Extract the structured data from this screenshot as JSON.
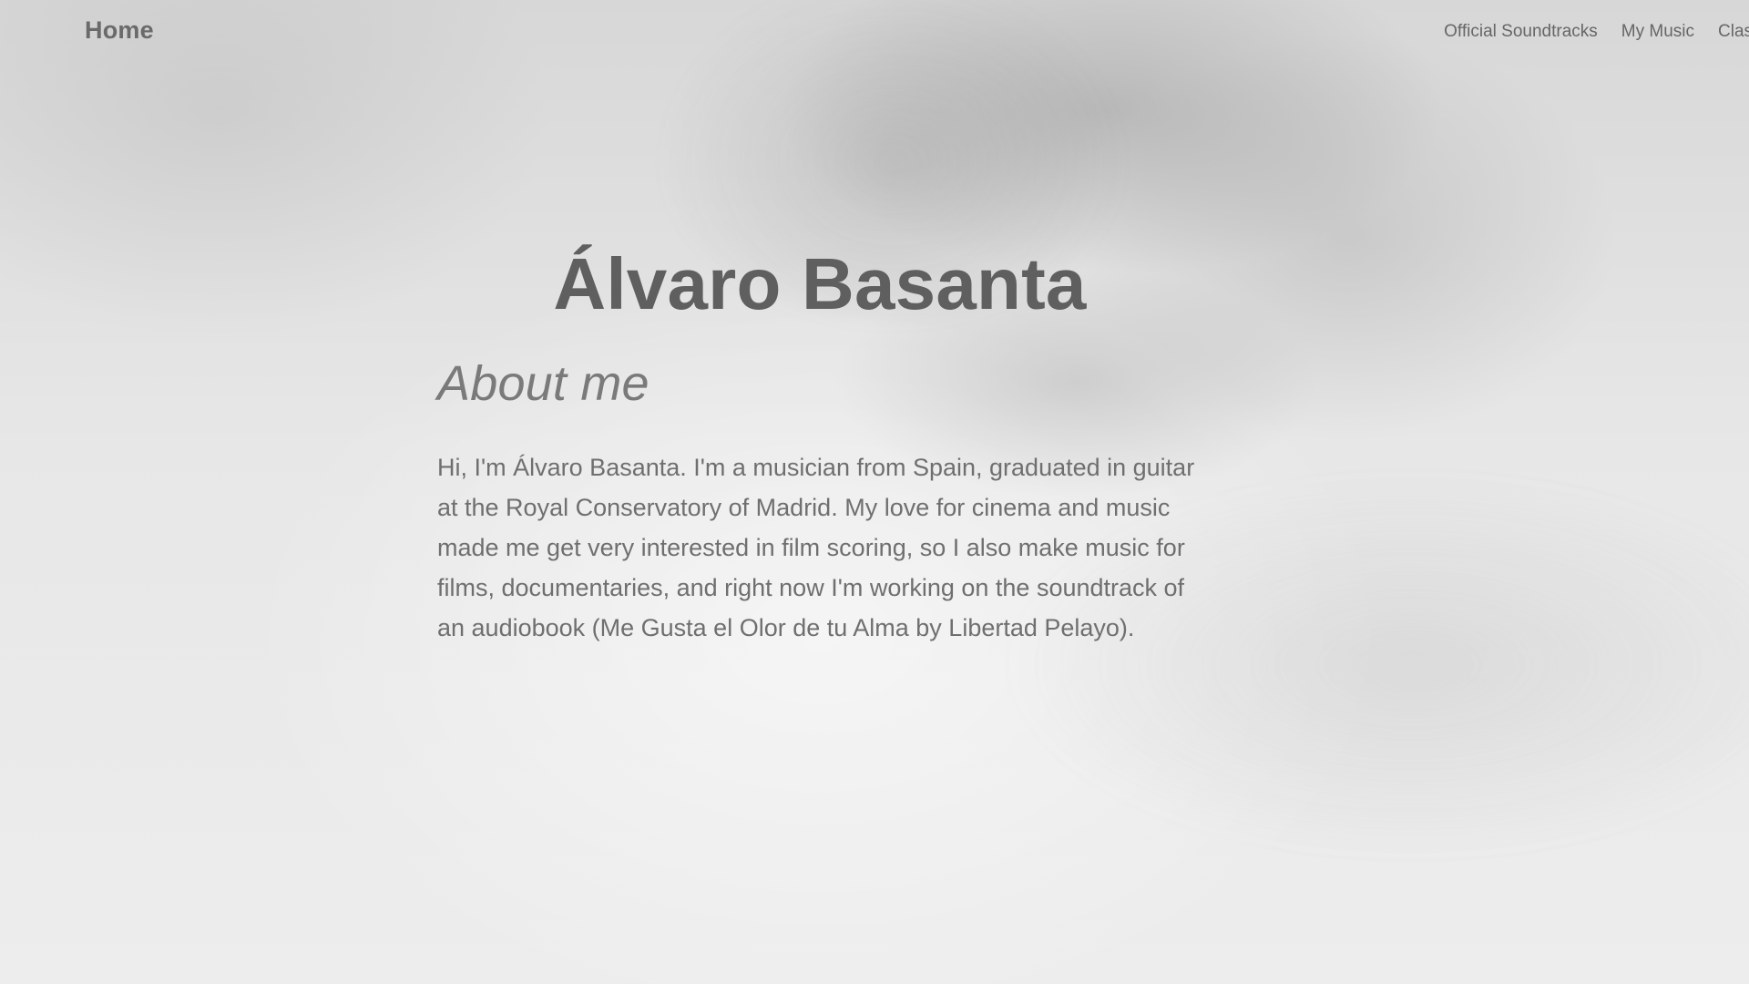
{
  "nav": {
    "brand": "Home",
    "items": [
      {
        "label": "Official Soundtracks"
      },
      {
        "label": "My Music"
      },
      {
        "label": "Clas"
      }
    ]
  },
  "hero": {
    "title": "Álvaro Basanta",
    "subtitle": "About me",
    "bio": "Hi, I'm Álvaro Basanta. I'm a musician from Spain, graduated in guitar at the Royal Conservatory of Madrid. My love for cinema and music made me get very interested in film scoring, so I also make music for films, documentaries, and right now I'm working on the soundtrack of an audiobook (Me Gusta el Olor de tu Alma by Libertad Pelayo)."
  }
}
